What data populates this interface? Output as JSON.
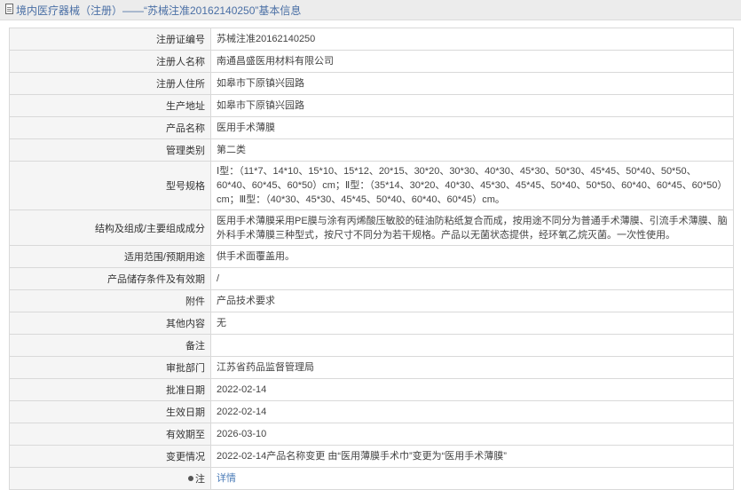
{
  "header": {
    "title": "境内医疗器械（注册）——“苏械注准20162140250”基本信息"
  },
  "rows": [
    {
      "label": "注册证编号",
      "value": "苏械注准20162140250"
    },
    {
      "label": "注册人名称",
      "value": "南通昌盛医用材料有限公司"
    },
    {
      "label": "注册人住所",
      "value": "如皋市下原镇兴园路"
    },
    {
      "label": "生产地址",
      "value": "如皋市下原镇兴园路"
    },
    {
      "label": "产品名称",
      "value": "医用手术薄膜"
    },
    {
      "label": "管理类别",
      "value": "第二类"
    },
    {
      "label": "型号规格",
      "value": "Ⅰ型：（11*7、14*10、15*10、15*12、20*15、30*20、30*30、40*30、45*30、50*30、45*45、50*40、50*50、60*40、60*45、60*50）cm；Ⅱ型：（35*14、30*20、40*30、45*30、45*45、50*40、50*50、60*40、60*45、60*50）cm；Ⅲ型：（40*30、45*30、45*45、50*40、60*40、60*45）cm。"
    },
    {
      "label": "结构及组成/主要组成成分",
      "value": "医用手术薄膜采用PE膜与涂有丙烯酸压敏胶的硅油防粘纸复合而成，按用途不同分为普通手术薄膜、引流手术薄膜、脑外科手术薄膜三种型式，按尺寸不同分为若干规格。产品以无菌状态提供，经环氧乙烷灭菌。一次性使用。"
    },
    {
      "label": "适用范围/预期用途",
      "value": "供手术面覆盖用。"
    },
    {
      "label": "产品储存条件及有效期",
      "value": "/"
    },
    {
      "label": "附件",
      "value": "产品技术要求"
    },
    {
      "label": "其他内容",
      "value": "无"
    },
    {
      "label": "备注",
      "value": ""
    },
    {
      "label": "审批部门",
      "value": "江苏省药品监督管理局"
    },
    {
      "label": "批准日期",
      "value": "2022-02-14"
    },
    {
      "label": "生效日期",
      "value": "2022-02-14"
    },
    {
      "label": "有效期至",
      "value": "2026-03-10"
    },
    {
      "label": "变更情况",
      "value": "2022-02-14产品名称变更 由“医用薄膜手术巾”变更为“医用手术薄膜”"
    }
  ],
  "note_row": {
    "label": "注",
    "link": "详情"
  }
}
